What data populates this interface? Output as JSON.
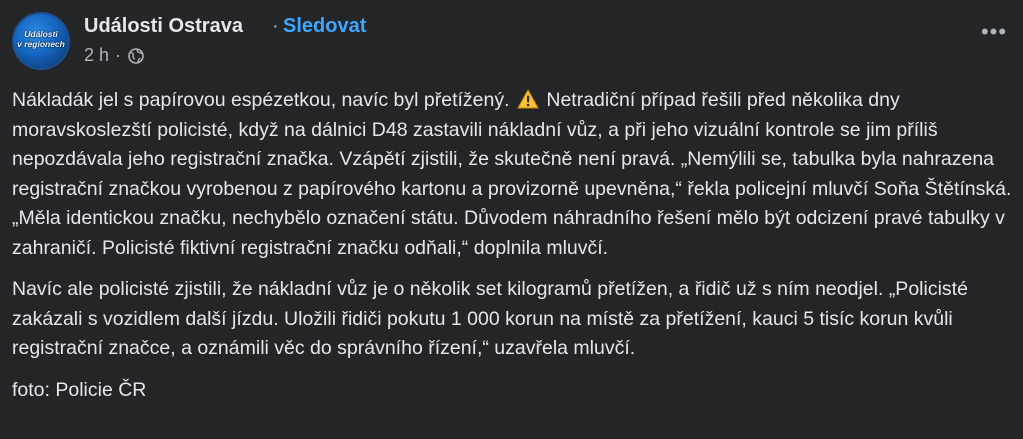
{
  "post": {
    "page_name": "Události Ostrava",
    "separator": "·",
    "follow_label": "Sledovat",
    "time": "2 h",
    "meta_sep": "·",
    "avatar_text_line1": "Události",
    "avatar_text_line2": "v regionech",
    "more_label": "•••",
    "paragraphs": {
      "p1_part1": "Nákladák jel s papírovou espézetkou, navíc byl přetížený.",
      "p1_part2": "Netradiční případ řešili před několika dny moravskoslezští policisté, když na dálnici D48 zastavili nákladní vůz, a při jeho vizuální kontrole se jim příliš nepozdávala jeho registrační značka. Vzápětí zjistili, že skutečně není pravá. „Nemýlili se, tabulka byla nahrazena registrační značkou vyrobenou z papírového kartonu a provizorně upevněna,“ řekla policejní mluvčí Soňa Štětínská. „Měla identickou značku, nechybělo označení státu. Důvodem náhradního řešení mělo být odcizení pravé tabulky v zahraničí. Policisté fiktivní registrační značku odňali,“ doplnila mluvčí.",
      "p2": "Navíc ale policisté zjistili, že nákladní vůz je o několik set kilogramů přetížen, a řidič už s ním neodjel. „Policisté zakázali s vozidlem další jízdu. Uložili řidiči pokutu 1 000 korun na místě za přetížení, kauci 5 tisíc korun kvůli registrační značce, a oznámili věc do správního řízení,“ uzavřela mluvčí.",
      "p3": "foto: Policie ČR"
    }
  },
  "icons": {
    "globe": "globe-icon",
    "warning": "warning-icon",
    "more": "more-dots-icon"
  },
  "colors": {
    "background": "#242526",
    "text": "#e4e6eb",
    "secondary": "#b0b3b8",
    "link": "#3ea6ff"
  }
}
